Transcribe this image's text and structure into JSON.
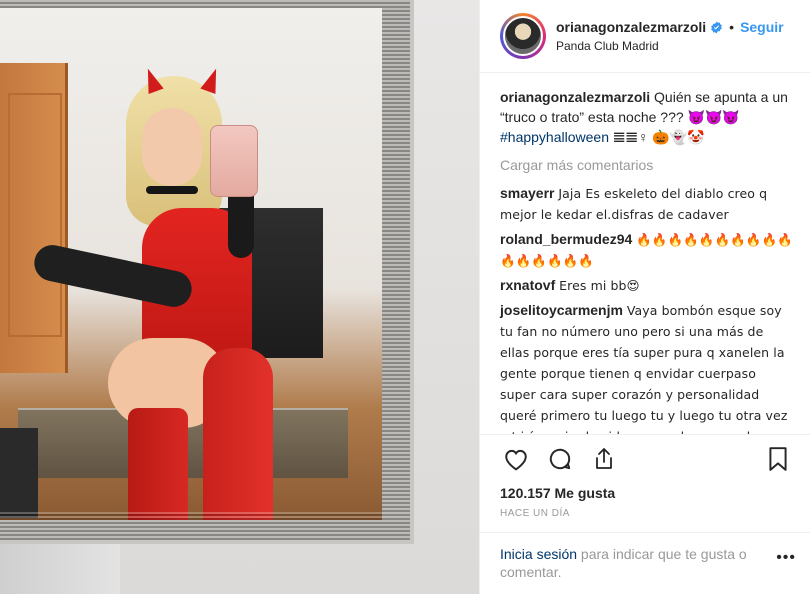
{
  "header": {
    "username": "orianagonzalezmarzoli",
    "separator": "•",
    "follow_label": "Seguir",
    "location": "Panda Club Madrid"
  },
  "caption": {
    "username": "orianagonzalezmarzoli",
    "text": "Quién se apunta a un “truco o trato” esta noche ??? 😈😈😈",
    "hashtag": "#happyhalloween",
    "trailing": "𝌆𝌆♀ 🎃👻🤡"
  },
  "load_more_label": "Cargar más comentarios",
  "comments": [
    {
      "username": "smayerr",
      "text": "Jaja Es eskeleto del diablo creo q mejor le kedar el.disfras de cadaver"
    },
    {
      "username": "roland_bermudez94",
      "text": "🔥🔥🔥🔥🔥🔥🔥🔥🔥🔥🔥🔥🔥🔥🔥🔥"
    },
    {
      "username": "rxnatovf",
      "text": "Eres mi bb😍"
    },
    {
      "username": "joselitoycarmenjm",
      "text": "Vaya bombón esque soy tu fan no número uno pero si una más de ellas porque eres tía super pura q xanelen la gente porque tienen q envidar cuerpaso super cara super corazón y personalidad queré primero tu luego tu y luego tu otra vez y t iría mejor la vida porque la aprovechas bien pero t pierde el corazón como ami asíq primero tu luego tu y luego"
    }
  ],
  "likes_count": "120.157",
  "likes_label": "Me gusta",
  "time_label": "HACE UN DÍA",
  "footer": {
    "login_label": "Inicia sesión",
    "rest": " para indicar que te gusta o comentar.",
    "more_label": "•••"
  },
  "colors": {
    "link": "#3897f0",
    "hashtag": "#003569",
    "muted": "#999999",
    "text": "#262626"
  },
  "icons": {
    "verified": "verified-badge-icon",
    "like": "heart-icon",
    "comment": "comment-bubble-icon",
    "share": "share-icon",
    "save": "bookmark-icon"
  }
}
